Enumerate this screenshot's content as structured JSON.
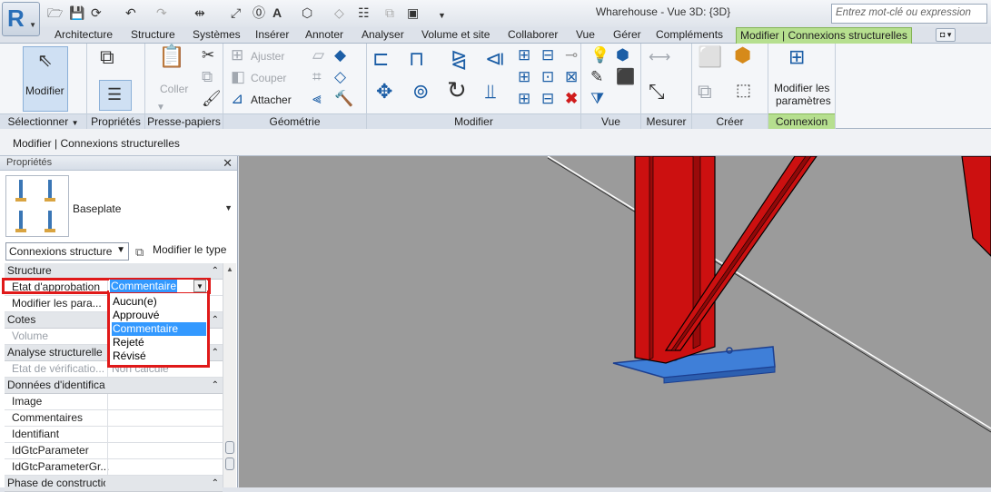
{
  "app": {
    "logo": "R",
    "window_title": "Wharehouse - Vue 3D: {3D}",
    "search_placeholder": "Entrez mot-clé ou expression"
  },
  "tabs": [
    "Architecture",
    "Structure",
    "Systèmes",
    "Insérer",
    "Annoter",
    "Analyser",
    "Volume et site",
    "Collaborer",
    "Vue",
    "Gérer",
    "Compléments",
    "Modifier | Connexions structurelles"
  ],
  "ribbon": {
    "selectionner": {
      "button": "Modifier",
      "label": "Sélectionner"
    },
    "proprietes": {
      "label": "Propriétés"
    },
    "presse_papiers": {
      "coller": "Coller",
      "label": "Presse-papiers"
    },
    "geometrie": {
      "ajuster": "Ajuster",
      "couper": "Couper",
      "attacher": "Attacher",
      "label": "Géométrie"
    },
    "modifier": {
      "label": "Modifier"
    },
    "vue": {
      "label": "Vue"
    },
    "mesurer": {
      "label": "Mesurer"
    },
    "creer": {
      "label": "Créer"
    },
    "connexion": {
      "button_line1": "Modifier les",
      "button_line2": "paramètres",
      "label": "Connexion"
    }
  },
  "context_bar": "Modifier | Connexions structurelles",
  "properties": {
    "header": "Propriétés",
    "type_name": "Baseplate",
    "filter": "Connexions structure",
    "edit_type": "Modifier le type",
    "rows": [
      {
        "kind": "group",
        "name": "Structure"
      },
      {
        "kind": "param",
        "name": "Etat d'approbation",
        "value": "Commentaire"
      },
      {
        "kind": "param",
        "name": "Modifier les para...",
        "value": ""
      },
      {
        "kind": "group",
        "name": "Cotes"
      },
      {
        "kind": "param",
        "name": "Volume",
        "value": "",
        "disabled": true
      },
      {
        "kind": "group",
        "name": "Analyse structurelle"
      },
      {
        "kind": "param",
        "name": "Etat de vérificatio...",
        "value": "Non calculé",
        "disabled": true
      },
      {
        "kind": "group",
        "name": "Données d'identification"
      },
      {
        "kind": "param",
        "name": "Image",
        "value": ""
      },
      {
        "kind": "param",
        "name": "Commentaires",
        "value": ""
      },
      {
        "kind": "param",
        "name": "Identifiant",
        "value": ""
      },
      {
        "kind": "param",
        "name": "IdGtcParameter",
        "value": ""
      },
      {
        "kind": "param",
        "name": "IdGtcParameterGr...",
        "value": ""
      },
      {
        "kind": "group",
        "name": "Phase de construction"
      }
    ]
  },
  "dropdown": {
    "selected": "Commentaire",
    "options": [
      "Aucun(e)",
      "Approuvé",
      "Commentaire",
      "Rejeté",
      "Révisé"
    ]
  },
  "colors": {
    "accent_green": "#b6df8f",
    "highlight_red": "#e01919",
    "selection_blue": "#3399ff",
    "steel_red": "#cc1010",
    "plate_blue": "#4a8fe0"
  }
}
